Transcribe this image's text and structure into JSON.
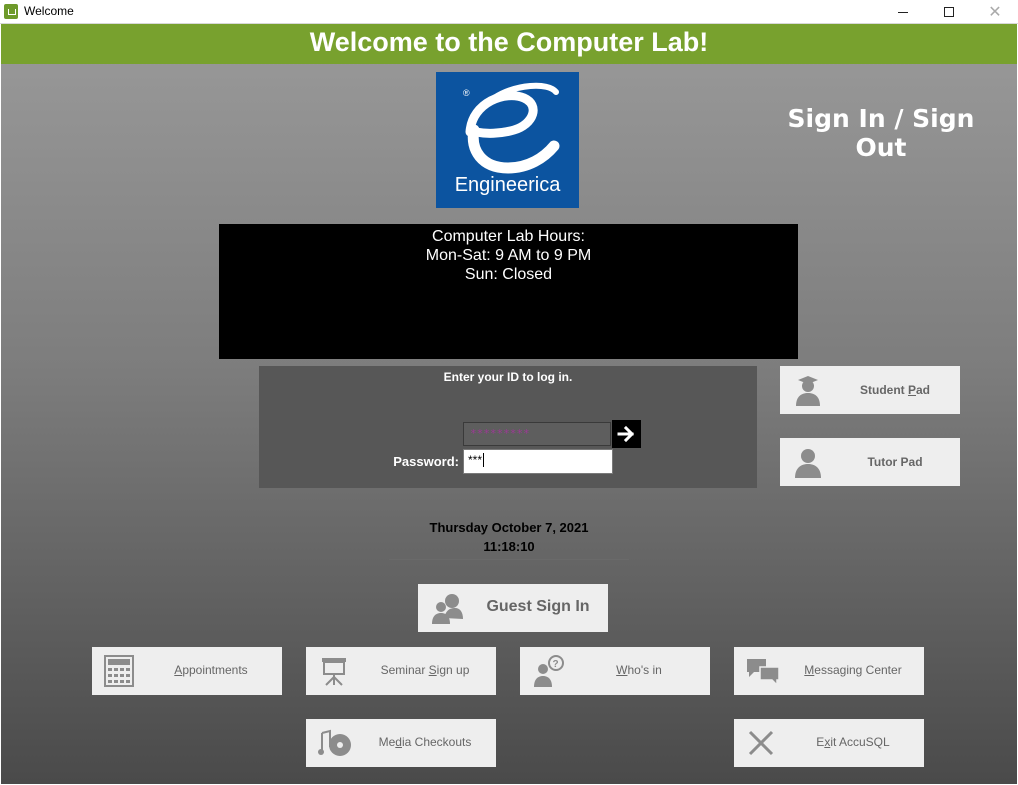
{
  "window": {
    "title": "Welcome",
    "controls": {
      "minimize": "–",
      "maximize": "☐",
      "close": "✕"
    }
  },
  "banner": {
    "title": "Welcome to the Computer Lab!"
  },
  "logo": {
    "text": "Engineerica",
    "mark": "®",
    "color": "#0c54a0"
  },
  "header": {
    "mode": "Sign In / Sign Out"
  },
  "hours": {
    "line1": "Computer Lab Hours:",
    "line2": "Mon-Sat: 9 AM to 9 PM",
    "line3": "Sun: Closed"
  },
  "login": {
    "prompt": "Enter your ID to log in.",
    "id_value": "*********",
    "password_label": "Password:",
    "password_value": "***"
  },
  "side_buttons": {
    "student_pad": {
      "label": "Student Pad",
      "pre": "Student ",
      "mnemonic": "P",
      "post": "ad"
    },
    "tutor_pad": {
      "label": "Tutor Pad"
    }
  },
  "datetime": {
    "date": "Thursday October 7, 2021",
    "time": "11:18:10"
  },
  "guest": {
    "label": "Guest Sign In"
  },
  "buttons": {
    "appointments": {
      "label": "Appointments",
      "mnemonic": "A",
      "rest": "ppointments"
    },
    "seminar": {
      "label": "Seminar Sign up",
      "pre": "Seminar ",
      "mnemonic": "S",
      "post": "ign up"
    },
    "whos_in": {
      "label": "Who's in",
      "mnemonic": "W",
      "rest": "ho's in"
    },
    "messaging": {
      "label": "Messaging Center",
      "mnemonic": "M",
      "rest": "essaging Center"
    },
    "media": {
      "label": "Media Checkouts",
      "pre": "Me",
      "mnemonic": "d",
      "post": "ia Checkouts"
    },
    "exit": {
      "label": "Exit AccuSQL",
      "pre": "E",
      "mnemonic": "x",
      "post": "it AccuSQL"
    }
  },
  "colors": {
    "banner": "#78a12e",
    "panel": "#575757",
    "button_bg": "#eeeeee",
    "button_text": "#666666"
  }
}
